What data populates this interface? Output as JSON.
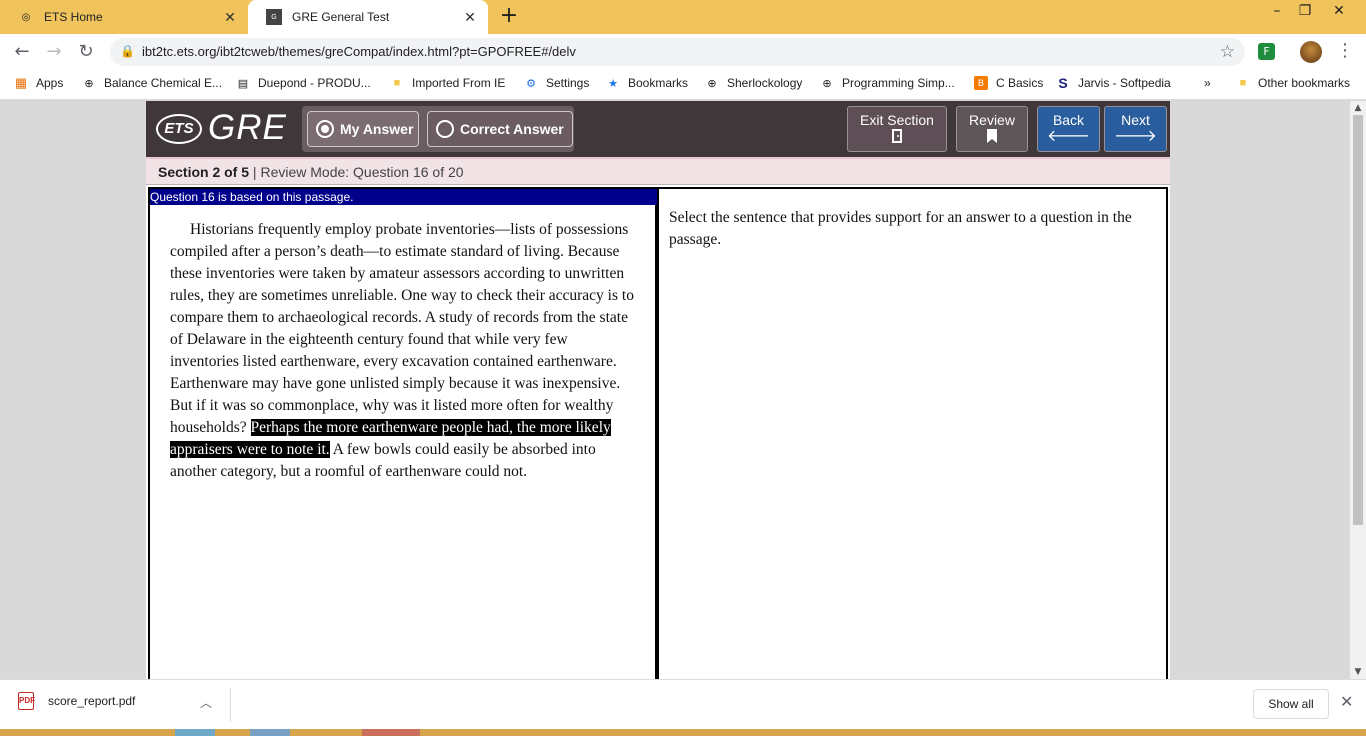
{
  "browser": {
    "tabs": [
      {
        "title": "ETS Home",
        "icon": "ets-favicon"
      },
      {
        "title": "GRE General Test",
        "icon": "gre-favicon"
      }
    ],
    "new_tab_symbol": "+",
    "window_controls": {
      "minimize": "–",
      "restore": "❐",
      "close": "✕"
    },
    "url": "ibt2tc.ets.org/ibt2tcweb/themes/greCompat/index.html?pt=GPOFREE#/delv",
    "bookmarks": [
      {
        "label": "Apps",
        "icon": "apps-grid-icon"
      },
      {
        "label": "Balance Chemical E...",
        "icon": "globe-icon"
      },
      {
        "label": "Duepond - PRODU...",
        "icon": "page-icon"
      },
      {
        "label": "Imported From IE",
        "icon": "folder-icon"
      },
      {
        "label": "Settings",
        "icon": "gear-icon"
      },
      {
        "label": "Bookmarks",
        "icon": "star-icon"
      },
      {
        "label": "Sherlockology",
        "icon": "globe-icon"
      },
      {
        "label": "Programming Simp...",
        "icon": "globe-icon"
      },
      {
        "label": "C Basics",
        "icon": "blogger-icon"
      },
      {
        "label": "Jarvis - Softpedia",
        "icon": "s-logo-icon"
      }
    ],
    "overflow_symbol": "»",
    "other_bookmarks": "Other bookmarks"
  },
  "gre": {
    "logo_ets": "ETS",
    "logo_gre": "GRE",
    "mode_buttons": {
      "my_answer": "My Answer",
      "correct_answer": "Correct Answer"
    },
    "nav": {
      "exit_section": "Exit Section",
      "review": "Review",
      "back": "Back",
      "next": "Next"
    },
    "status": {
      "section": "Section 2 of 5",
      "separator": " | ",
      "mode": "Review Mode: Question 16 of 20"
    },
    "passage_heading": "Question 16 is based on this passage.",
    "passage": {
      "before": "Historians frequently employ probate inventories—lists of possessions compiled after a person’s death—to estimate standard of living. Because these inventories were taken by amateur assessors according to unwritten rules, they are sometimes unreliable. One way to check their accuracy is to compare them to archaeological records. A study of records from the state of Delaware in the eighteenth century found that while very few inventories listed earthenware, every excavation contained earthenware. Earthenware may have gone unlisted simply because it was inexpensive. But if it was so commonplace, why was it listed more often for wealthy households? ",
      "highlighted": "Perhaps the more earthenware people had, the more likely appraisers were to note it.",
      "after": " A few bowls could easily be absorbed into another category, but a roomful of earthenware could not."
    },
    "question": "Select the sentence that provides support for an answer to a question in the passage."
  },
  "downloads": {
    "file": "score_report.pdf",
    "show_all": "Show all"
  }
}
